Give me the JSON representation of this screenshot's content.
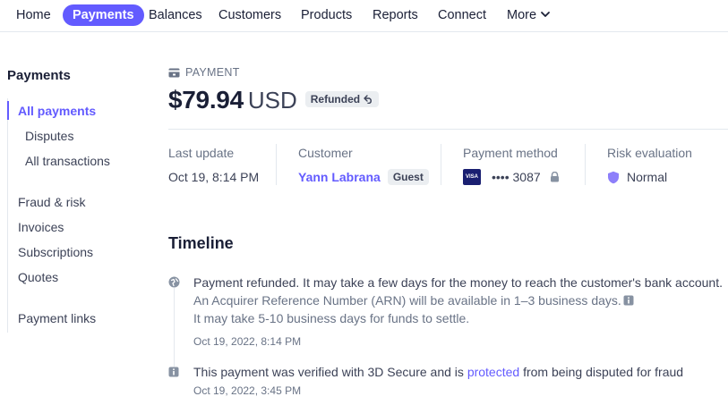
{
  "nav": {
    "items": [
      {
        "label": "Home",
        "active": false
      },
      {
        "label": "Payments",
        "active": true
      },
      {
        "label": "Balances",
        "active": false
      },
      {
        "label": "Customers",
        "active": false
      },
      {
        "label": "Products",
        "active": false
      },
      {
        "label": "Reports",
        "active": false
      },
      {
        "label": "Connect",
        "active": false
      },
      {
        "label": "More",
        "active": false
      }
    ]
  },
  "sidebar": {
    "title": "Payments",
    "items": [
      {
        "label": "All payments",
        "active": true
      },
      {
        "label": "Disputes"
      },
      {
        "label": "All transactions"
      },
      {
        "label": "Fraud & risk"
      },
      {
        "label": "Invoices"
      },
      {
        "label": "Subscriptions"
      },
      {
        "label": "Quotes"
      },
      {
        "label": "Payment links"
      }
    ]
  },
  "header": {
    "kicker": "PAYMENT",
    "amount": "$79.94",
    "currency": "USD",
    "status_badge": "Refunded"
  },
  "summary": {
    "last_update": {
      "label": "Last update",
      "value": "Oct 19, 8:14 PM"
    },
    "customer": {
      "label": "Customer",
      "name": "Yann Labrana",
      "tag": "Guest"
    },
    "payment_method": {
      "label": "Payment method",
      "card_brand": "VISA",
      "last4": "•••• 3087"
    },
    "risk": {
      "label": "Risk evaluation",
      "value": "Normal"
    }
  },
  "timeline": {
    "title": "Timeline",
    "events": [
      {
        "line1": "Payment refunded. It may take a few days for the money to reach the customer's bank account.",
        "line2": "An Acquirer Reference Number (ARN) will be available in 1–3 business days.",
        "line3": "It may take 5-10 business days for funds to settle.",
        "time": "Oct 19, 2022, 8:14 PM"
      },
      {
        "text_before": "This payment was verified with 3D Secure and is ",
        "link": "protected",
        "text_after": " from being disputed for fraud",
        "time": "Oct 19, 2022, 3:45 PM"
      }
    ]
  },
  "colors": {
    "accent": "#635bff",
    "text": "#1a1f36",
    "muted": "#697386",
    "border": "#e3e8ee"
  }
}
